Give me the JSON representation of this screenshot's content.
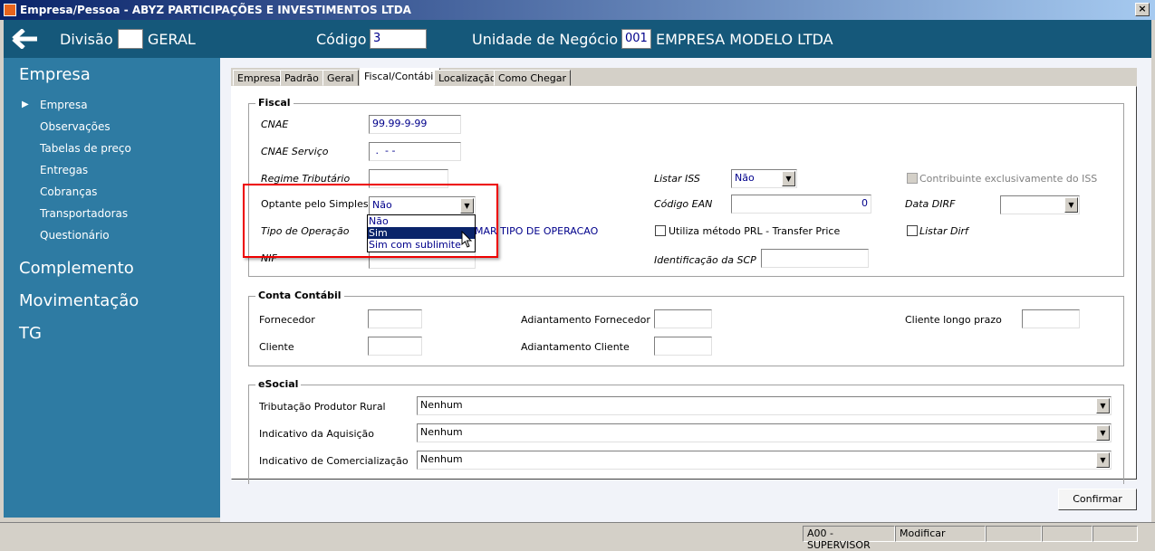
{
  "window": {
    "title": "Empresa/Pessoa - ABYZ PARTICIPAÇÕES E INVESTIMENTOS LTDA",
    "close": "×"
  },
  "header": {
    "back_icon": "arrow-left",
    "divisao_label": "Divisão",
    "divisao_value": "",
    "divisao_name": "GERAL",
    "codigo_label": "Código",
    "codigo_value": "3",
    "unidade_label": "Unidade de Negócio",
    "unidade_code": "001",
    "unidade_name": "EMPRESA MODELO LTDA"
  },
  "sidebar": {
    "sections": [
      "Empresa",
      "Complemento",
      "Movimentação",
      "TG"
    ],
    "items": [
      "Empresa",
      "Observações",
      "Tabelas de preço",
      "Entregas",
      "Cobranças",
      "Transportadoras",
      "Questionário"
    ],
    "active_marker": "▶"
  },
  "tabs": [
    "Empresa",
    "Padrão",
    "Geral",
    "Fiscal/Contábil",
    "Localização",
    "Como Chegar"
  ],
  "fiscal": {
    "title": "Fiscal",
    "cnae_label": "CNAE",
    "cnae_value": "99.99-9-99",
    "cnae_servico_label": "CNAE Serviço",
    "cnae_servico_value": " .  - -",
    "regime_label": "Regime Tributário",
    "regime_value": "",
    "optante_label": "Optante pelo Simples",
    "optante_value": "Não",
    "optante_options": [
      "Não",
      "Sim",
      "Sim com sublimite"
    ],
    "tipo_operacao_label": "Tipo de Operação",
    "tipo_operacao_value": "MAR TIPO DE OPERACAO",
    "nif_label": "NIF",
    "listar_iss_label": "Listar  ISS",
    "listar_iss_value": "Não",
    "codigo_ean_label": "Código EAN",
    "codigo_ean_value": "0",
    "prl_label": "Utiliza método PRL - Transfer Price",
    "scp_label": "Identificação da SCP",
    "contribuinte_label": "Contribuinte exclusivamente do ISS",
    "data_dirf_label": "Data DIRF",
    "listar_dirf_label": "Listar Dirf"
  },
  "conta": {
    "title": "Conta Contábil",
    "fornecedor": "Fornecedor",
    "cliente": "Cliente",
    "adiant_fornecedor": "Adiantamento Fornecedor",
    "adiant_cliente": "Adiantamento Cliente",
    "cliente_longo": "Cliente longo prazo"
  },
  "esocial": {
    "title": "eSocial",
    "rows": [
      {
        "label": "Tributação Produtor Rural",
        "value": "Nenhum"
      },
      {
        "label": "Indicativo da Aquisição",
        "value": "Nenhum"
      },
      {
        "label": "Indicativo de Comercialização",
        "value": "Nenhum"
      }
    ]
  },
  "confirm_label": "Confirmar",
  "status": {
    "user": "A00 - SUPERVISOR",
    "mode": "Modificar"
  }
}
